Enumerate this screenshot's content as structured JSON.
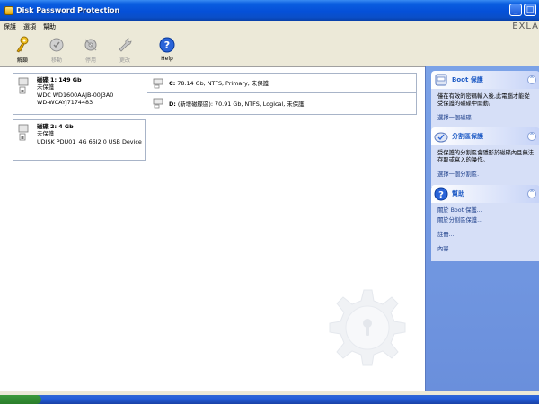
{
  "window": {
    "title": "Disk Password Protection",
    "brand": "EXLA"
  },
  "menu": {
    "items": [
      "保護",
      "選項",
      "幫助"
    ]
  },
  "toolbar": {
    "buttons": [
      {
        "label": "解鎖",
        "icon": "key-icon",
        "enabled": true
      },
      {
        "label": "移動",
        "icon": "shield-icon",
        "enabled": false
      },
      {
        "label": "停用",
        "icon": "gear-disk-icon",
        "enabled": false
      },
      {
        "label": "更改",
        "icon": "wrench-icon",
        "enabled": false
      },
      {
        "label": "Help",
        "icon": "help-icon",
        "enabled": true
      }
    ]
  },
  "disks": [
    {
      "title": "磁碟 1: 149 Gb",
      "status": "未保護",
      "model": "WDC WD1600AAJB-00J3A0",
      "serial": "WD-WCAYJ7174483",
      "partitions": [
        {
          "name": "C:",
          "info": "78.14 Gb, NTFS, Primary, 未保護"
        },
        {
          "name": "D:",
          "info": "(新增磁碟區): 70.91 Gb, NTFS, Logical, 未保護"
        }
      ]
    },
    {
      "title": "磁碟 2: 4 Gb",
      "status": "未保護",
      "model": "UDISK PDU01_4G 66I2.0 USB Device",
      "serial": "",
      "partitions": []
    }
  ],
  "taskpane": {
    "panels": [
      {
        "title": "Boot 保護",
        "description": "僅在有效的密碼輸入後,此電腦才能從受保護的磁碟中開動。",
        "links": [
          "選擇一個磁碟."
        ]
      },
      {
        "title": "分割區保護",
        "description": "受保護的分割區會隱形於磁碟內且無法存取或寫入的操作。",
        "links": [
          "選擇一個分割區."
        ]
      },
      {
        "title": "幫助",
        "description": "",
        "links": [
          "關於 Boot 保護...",
          "關於分割區保護...",
          "註冊...",
          "內容..."
        ]
      }
    ]
  },
  "colors": {
    "titlebar": "#0550d8",
    "pane_background": "#7ba2e7",
    "panel_body": "#d6dff7",
    "link": "#1d3f8a"
  }
}
